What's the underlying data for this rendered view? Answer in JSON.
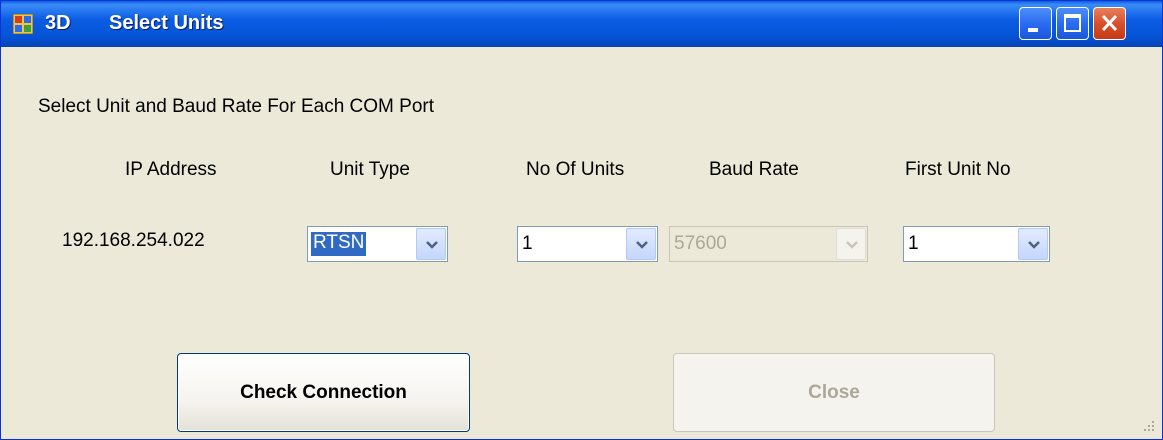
{
  "window": {
    "title_prefix": "3D",
    "title": "Select Units"
  },
  "instructions": "Select Unit and Baud Rate For Each COM Port",
  "headers": {
    "ip_address": "IP Address",
    "unit_type": "Unit Type",
    "no_of_units": "No Of Units",
    "baud_rate": "Baud Rate",
    "first_unit_no": "First Unit No"
  },
  "row": {
    "ip_address": "192.168.254.022",
    "unit_type": "RTSN",
    "no_of_units": "1",
    "baud_rate": "57600",
    "first_unit_no": "1"
  },
  "buttons": {
    "check_connection": "Check Connection",
    "close": "Close"
  },
  "colors": {
    "titlebar": "#0455d6",
    "selection": "#316ac5",
    "dialog_bg": "#ece9d8",
    "disabled_text": "#aca899"
  }
}
